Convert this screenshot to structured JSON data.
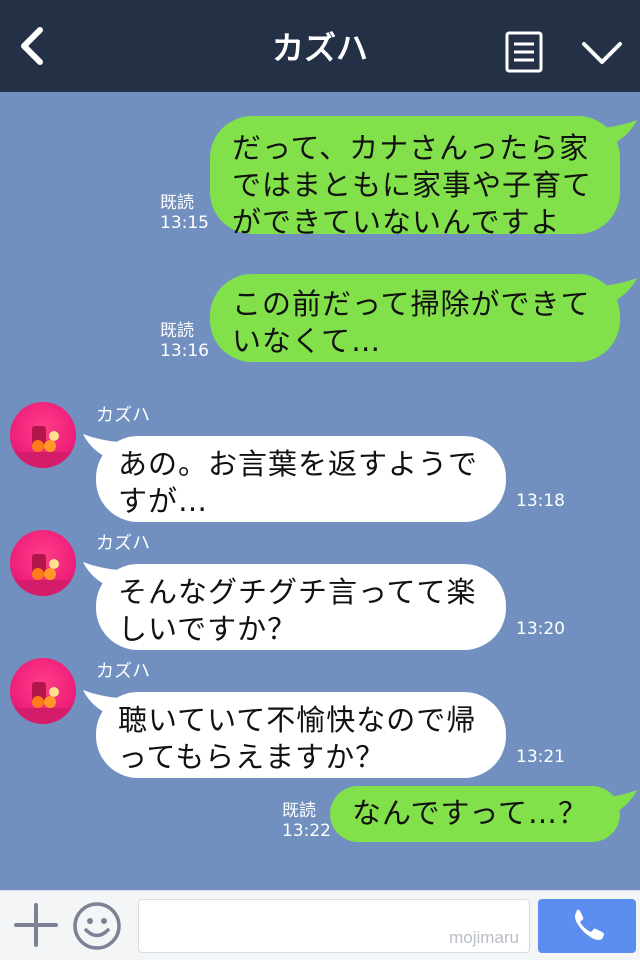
{
  "header": {
    "title": "カズハ",
    "back_icon": "chevron-left-icon",
    "notes_icon": "notes-icon",
    "menu_icon": "chevron-down-icon"
  },
  "messages": [
    {
      "from": "me",
      "lines": [
        "だって、カナさんったら家",
        "ではまともに家事や子育て",
        "ができていないんですよ"
      ],
      "read": "既読",
      "time": "13:15"
    },
    {
      "from": "me",
      "lines": [
        "この前だって掃除ができて",
        "いなくて…"
      ],
      "read": "既読",
      "time": "13:16"
    },
    {
      "from": "them",
      "sender": "カズハ",
      "lines": [
        "あの。お言葉を返すようで",
        "すが…"
      ],
      "time": "13:18"
    },
    {
      "from": "them",
      "sender": "カズハ",
      "lines": [
        "そんなグチグチ言ってて楽",
        "しいですか？"
      ],
      "time": "13:20"
    },
    {
      "from": "them",
      "sender": "カズハ",
      "lines": [
        "聴いていて不愉快なので帰",
        "ってもらえますか？"
      ],
      "time": "13:21"
    },
    {
      "from": "me",
      "lines": [
        "なんですって…？"
      ],
      "read": "既読",
      "time": "13:22"
    }
  ],
  "footer": {
    "input_value": "",
    "watermark": "mojimaru",
    "plus_icon": "plus-icon",
    "emoji_icon": "smiley-icon",
    "call_icon": "phone-icon"
  },
  "colors": {
    "header_bg": "#243046",
    "chat_bg": "#7190c0",
    "my_bubble": "#82e14a",
    "their_bubble": "#ffffff",
    "call_button": "#5b8ef0"
  }
}
